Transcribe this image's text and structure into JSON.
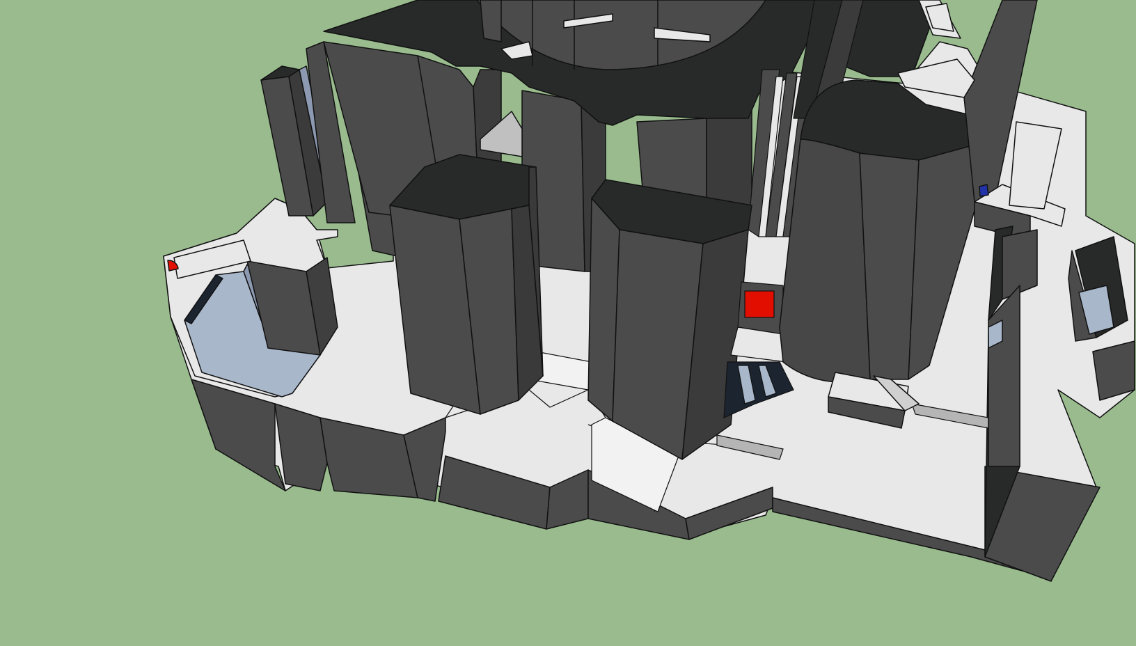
{
  "viewport": {
    "background": "#99bb8e",
    "model": {
      "shade_dark": "#272a29",
      "shade_mid": "#4b4b4b",
      "shade_light": "#e8e8e8",
      "accent_red": "#e20e00",
      "glass": "#a8b7ca"
    }
  }
}
